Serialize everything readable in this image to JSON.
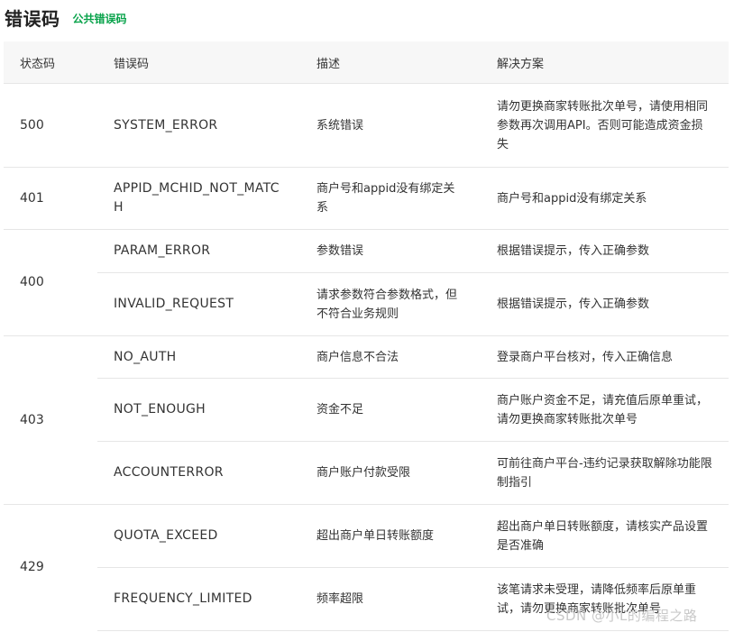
{
  "page": {
    "title": "错误码",
    "tag": "公共错误码"
  },
  "table": {
    "headers": [
      "状态码",
      "错误码",
      "描述",
      "解决方案"
    ],
    "groups": [
      {
        "status": "500",
        "rows": [
          {
            "code": "SYSTEM_ERROR",
            "desc": "系统错误",
            "solution": "请勿更换商家转账批次单号，请使用相同参数再次调用API。否则可能造成资金损失"
          }
        ]
      },
      {
        "status": "401",
        "rows": [
          {
            "code": "APPID_MCHID_NOT_MATCH",
            "desc": "商户号和appid没有绑定关系",
            "solution": "商户号和appid没有绑定关系"
          }
        ]
      },
      {
        "status": "400",
        "rows": [
          {
            "code": "PARAM_ERROR",
            "desc": "参数错误",
            "solution": "根据错误提示，传入正确参数"
          },
          {
            "code": "INVALID_REQUEST",
            "desc": "请求参数符合参数格式，但不符合业务规则",
            "solution": "根据错误提示，传入正确参数"
          }
        ]
      },
      {
        "status": "403",
        "rows": [
          {
            "code": "NO_AUTH",
            "desc": "商户信息不合法",
            "solution": "登录商户平台核对，传入正确信息"
          },
          {
            "code": "NOT_ENOUGH",
            "desc": "资金不足",
            "solution": "商户账户资金不足，请充值后原单重试，请勿更换商家转账批次单号"
          },
          {
            "code": "ACCOUNTERROR",
            "desc": "商户账户付款受限",
            "solution": "可前往商户平台-违约记录获取解除功能限制指引"
          }
        ]
      },
      {
        "status": "429",
        "rows": [
          {
            "code": "QUOTA_EXCEED",
            "desc": "超出商户单日转账额度",
            "solution": "超出商户单日转账额度，请核实产品设置是否准确"
          },
          {
            "code": "FREQUENCY_LIMITED",
            "desc": "频率超限",
            "solution": "该笔请求未受理，请降低频率后原单重试，请勿更换商家转账批次单号"
          }
        ]
      }
    ]
  },
  "watermark": "CSDN @小L的编程之路"
}
